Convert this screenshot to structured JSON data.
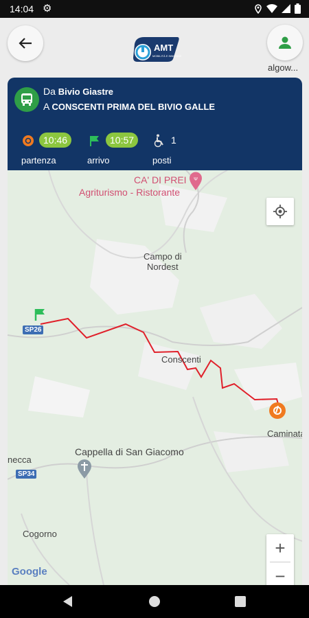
{
  "status": {
    "time": "14:04"
  },
  "header": {
    "username": "algow...",
    "logo_text": "AMT",
    "logo_subtext": "MOBILITÀ E INNOVAZIONE"
  },
  "trip": {
    "from_prefix": "Da",
    "from": "Bivio Giastre",
    "to_prefix": "A",
    "to": "CONSCENTI PRIMA DEL BIVIO GALLE",
    "departure_time": "10:46",
    "departure_label": "partenza",
    "arrival_time": "10:57",
    "arrival_label": "arrivo",
    "seats": "1",
    "seats_label": "posti"
  },
  "map": {
    "labels": {
      "poi_name": "CA' DI PREI",
      "poi_type": "Agriturismo - Ristorante",
      "campo": "Campo di\nNordest",
      "conscenti": "Conscenti",
      "caminata": "Caminata",
      "cappella": "Cappella di San Giacomo",
      "cogorno": "Cogorno",
      "necca": "necca",
      "google": "Google",
      "sp26": "SP26",
      "sp34": "SP34"
    }
  },
  "colors": {
    "card_bg": "#123566",
    "route": "#e0202a",
    "pill": "#8cc63f",
    "start_flag": "#2dbd5a",
    "end_pin": "#f07a20"
  }
}
